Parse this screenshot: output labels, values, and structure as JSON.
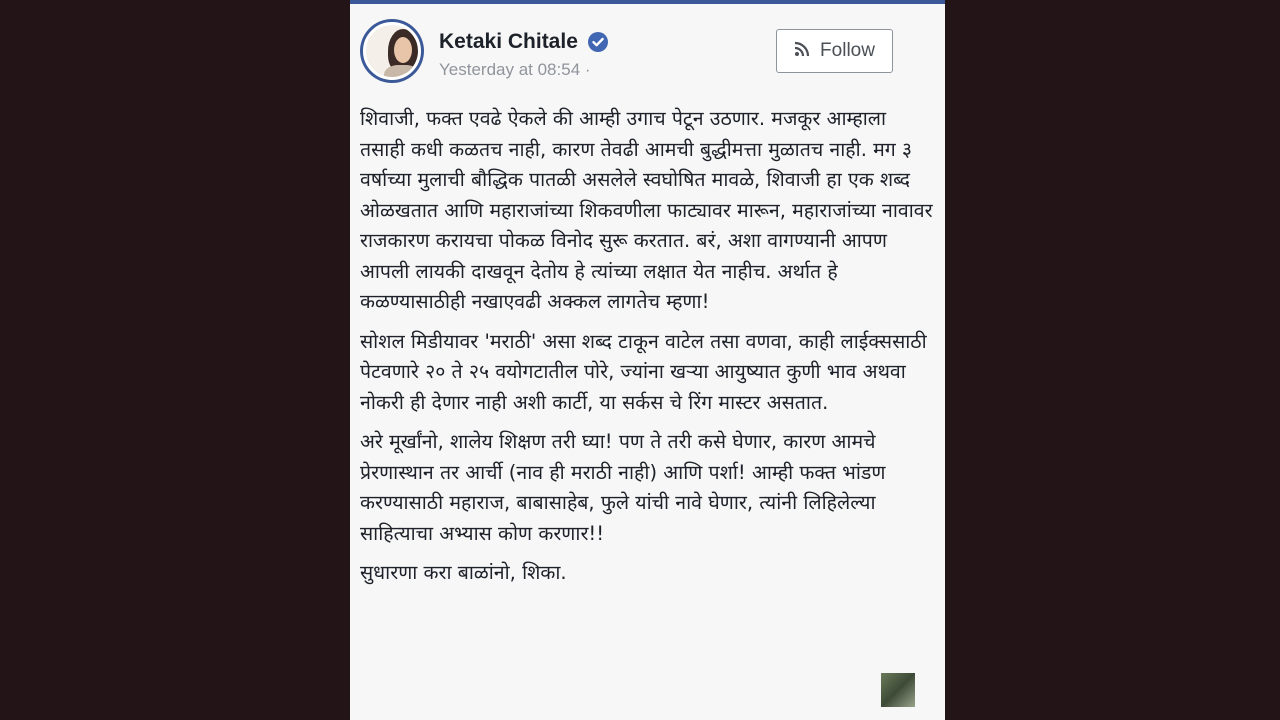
{
  "post": {
    "author_name": "Ketaki Chitale",
    "timestamp": "Yesterday at 08:54 ·",
    "follow_label": "Follow",
    "paragraphs": [
      "शिवाजी, फक्त एवढे ऐकले की आम्ही उगाच पेटून उठणार. मजकूर आम्हाला तसाही कधी कळतच नाही, कारण तेवढी आमची बुद्धीमत्ता मुळातच नाही. मग ३ वर्षाच्या मुलाची बौद्धिक पातळी असलेले स्वघोषित मावळे, शिवाजी हा एक शब्द ओळखतात आणि महाराजांच्या शिकवणीला फाट्यावर मारून, महाराजांच्या नावावर राजकारण करायचा पोकळ विनोद सुरू करतात. बरं, अशा वागण्यानी आपण आपली लायकी दाखवून देतोय हे त्यांच्या लक्षात येत नाहीच. अर्थात हे कळण्यासाठीही नखाएवढी अक्कल लागतेच म्हणा!",
      "सोशल मिडीयावर 'मराठी' असा शब्द टाकून वाटेल तसा वणवा, काही लाईक्ससाठी पेटवणारे २० ते २५ वयोगटातील पोरे, ज्यांना खऱ्या आयुष्यात कुणी भाव अथवा नोकरी ही देणार नाही अशी कार्टी, या सर्कस चे रिंग मास्टर असतात.",
      "अरे मूर्खांनो, शालेय शिक्षण तरी घ्या! पण ते तरी कसे घेणार, कारण आमचे प्रेरणास्थान तर आर्ची (नाव ही मराठी नाही) आणि पर्शा! आम्ही फक्त भांडण करण्यासाठी महाराज, बाबासाहेब, फुले यांची नावे घेणार, त्यांनी लिहिलेल्या साहित्याचा अभ्यास कोण करणार!!",
      "सुधारणा करा बाळांनो, शिका."
    ]
  },
  "colors": {
    "background": "#231418",
    "card": "#f7f7f7",
    "accent": "#3b5998",
    "verified": "#4267b2",
    "text": "#1d2129",
    "muted": "#90949c"
  },
  "icons": [
    "verified-badge-icon",
    "rss-icon"
  ]
}
